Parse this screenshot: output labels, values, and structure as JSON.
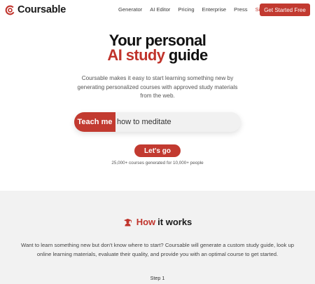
{
  "brand": {
    "name": "Coursable",
    "accent": "#c0332b"
  },
  "nav": {
    "links": [
      "Generator",
      "AI Editor",
      "Pricing",
      "Enterprise",
      "Press"
    ],
    "signin": "Sign in",
    "cta": "Get Started Free"
  },
  "hero": {
    "title_line1": "Your personal",
    "title_accent": "AI study",
    "title_rest": "guide",
    "description": "Coursable makes it easy to start learning something new by generating personalized courses with approved study materials from the web.",
    "teach_label": "Teach me",
    "input_value": "how to meditate",
    "go_label": "Let's go",
    "stats": "25,000+ courses generated for 10,000+ people"
  },
  "how_it_works": {
    "icon": "graduate-icon",
    "title_accent": "How",
    "title_rest": "it works",
    "description": "Want to learn something new but don't know where to start? Coursable will generate a custom study guide, look up online learning materials, evaluate their quality, and provide you with an optimal course to get started.",
    "step_label": "Step 1"
  }
}
